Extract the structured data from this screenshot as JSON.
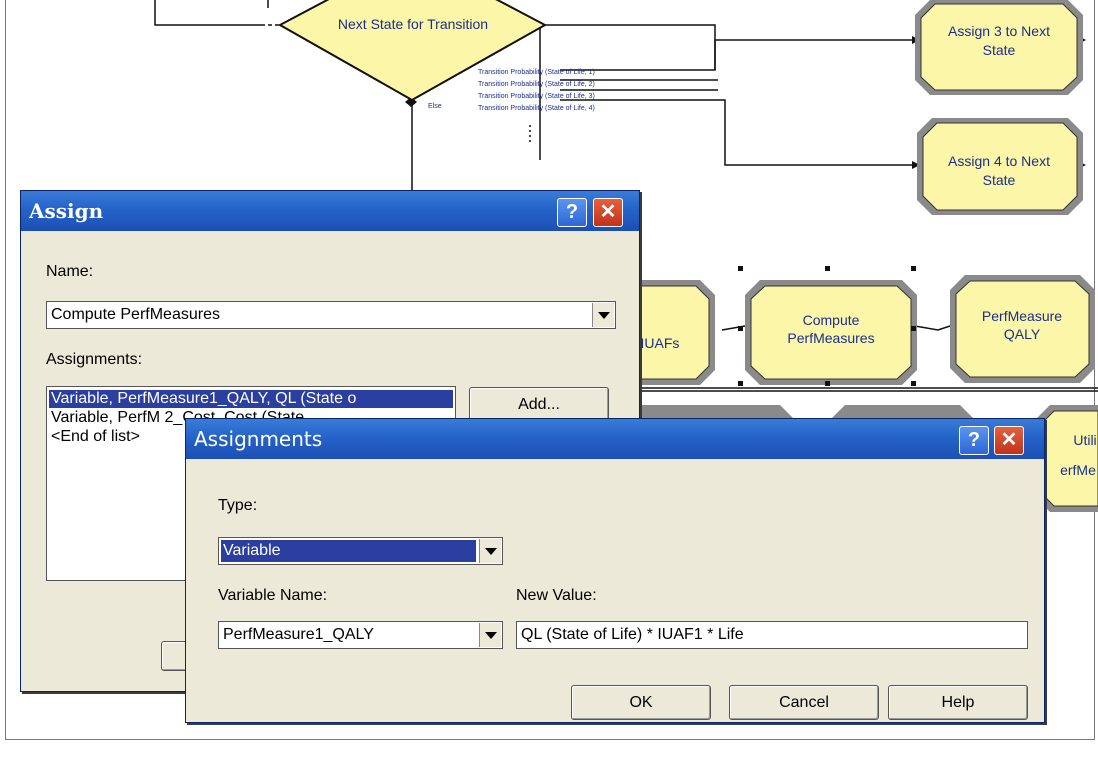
{
  "flowchart": {
    "decision_label": "Next State for Transition",
    "else_label": "Else",
    "transition_labels": [
      "Transition Probability (State of Life, 1)",
      "Transition Probability (State of Life, 2)",
      "Transition Probability (State of Life, 3)",
      "Transition Probability (State of Life, 4)"
    ],
    "blocks": {
      "assign3": [
        "Assign 3 to Next",
        "State"
      ],
      "assign4": [
        "Assign 4 to Next",
        "State"
      ],
      "iuafs": "IUAFs",
      "compute": [
        "Compute",
        "PerfMeasures"
      ],
      "qaly": [
        "PerfMeasure",
        "QALY"
      ],
      "utility": [
        "Utili",
        "erfMe"
      ]
    }
  },
  "assign_dialog": {
    "title": "Assign",
    "help_glyph": "?",
    "name_label": "Name:",
    "name_value": "Compute PerfMeasures",
    "assignments_label": "Assignments:",
    "assignments": [
      "Variable, PerfMeasure1_QALY, QL (State o",
      "Variable, PerfM                2_Cost, Cost (State",
      "<End of list>"
    ],
    "add_label": "Add..."
  },
  "assignments_dialog": {
    "title": "Assignments",
    "help_glyph": "?",
    "type_label": "Type:",
    "type_value": "Variable",
    "variable_name_label": "Variable Name:",
    "variable_name_value": "PerfMeasure1_QALY",
    "new_value_label": "New Value:",
    "new_value_value": "QL (State of Life) * IUAF1 * Life",
    "ok_label": "OK",
    "cancel_label": "Cancel",
    "help_label": "Help"
  },
  "colors": {
    "block_fill": "#fbf6a8",
    "titlebar": "#2563c9",
    "dialog_bg": "#ece9d8",
    "selection": "#2b3fa0"
  }
}
